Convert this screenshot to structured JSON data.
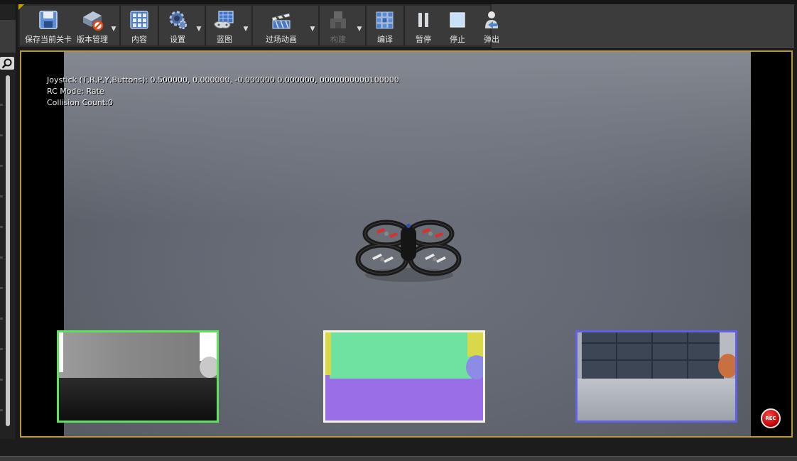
{
  "toolbar": {
    "save_level": "保存当前关卡",
    "source_control": "版本管理",
    "content": "内容",
    "settings": "设置",
    "blueprints": "蓝图",
    "cinematics": "过场动画",
    "build": "构建",
    "compile": "编译",
    "pause": "暂停",
    "stop": "停止",
    "eject": "弹出",
    "icons": [
      "save-icon",
      "source-control-icon",
      "content-icon",
      "settings-icon",
      "blueprint-icon",
      "cinematics-icon",
      "build-icon",
      "compile-icon",
      "pause-icon",
      "stop-icon",
      "eject-icon"
    ]
  },
  "viewport": {
    "joystick_line": "Joystick (T,R,P,Y,Buttons): 0.500000, 0.000000, -0.000000 0.000000, 0000000000100000",
    "rc_mode_line": "RC Mode: Rate",
    "collision_line": "Collision Count:0",
    "record_label": "REC",
    "subviews": [
      "depth-view",
      "segmentation-view",
      "scene-view"
    ]
  },
  "colors": {
    "accent_border": "#b8963a",
    "depth_border": "#5fe35f",
    "segmentation_border": "#f4f4dc",
    "scene_border": "#6060e8",
    "record": "#d00000"
  }
}
